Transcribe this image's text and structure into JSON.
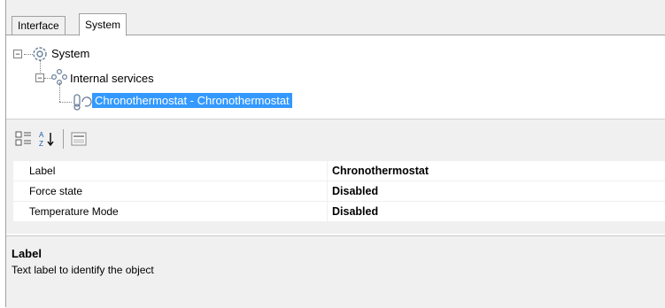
{
  "tabs": [
    {
      "label": "Interface",
      "active": false
    },
    {
      "label": "System",
      "active": true
    }
  ],
  "tree": {
    "root": {
      "label": "System",
      "icon": "gear-icon",
      "expander": "−"
    },
    "child": {
      "label": "Internal services",
      "icon": "network-nodes-icon",
      "expander": "−"
    },
    "leaf": {
      "label": "Chronothermostat - Chronothermostat",
      "icon": "thermostat-icon",
      "selected": true
    }
  },
  "toolbar": {
    "categorized_icon": "categorized-view-icon",
    "alphabetical_icon": "sort-alphabetical-icon",
    "pages_icon": "property-pages-icon"
  },
  "properties": [
    {
      "name": "Label",
      "value": "Chronothermostat"
    },
    {
      "name": "Force state",
      "value": "Disabled"
    },
    {
      "name": "Temperature Mode",
      "value": "Disabled"
    }
  ],
  "description": {
    "title": "Label",
    "text": "Text label to identify the object"
  },
  "colors": {
    "selection": "#3399ff",
    "panel_bg": "#f0f0f0",
    "border": "#a0a0a0"
  }
}
